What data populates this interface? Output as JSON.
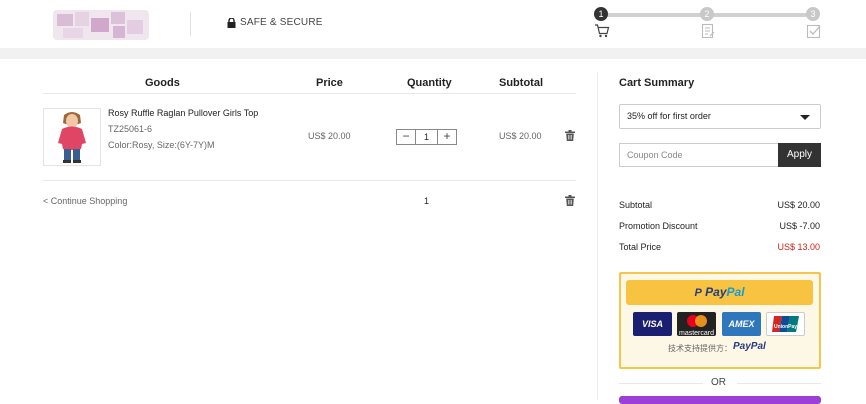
{
  "header": {
    "secure_label": "SAFE & SECURE",
    "steps": [
      "1",
      "2",
      "3"
    ]
  },
  "cart": {
    "columns": [
      "Goods",
      "Price",
      "Quantity",
      "Subtotal"
    ],
    "items": [
      {
        "name": "Rosy Ruffle Raglan Pullover Girls Top",
        "sku": "TZ25061-6",
        "options": "Color:Rosy, Size:(6Y-7Y)M",
        "price": "US$ 20.00",
        "quantity": "1",
        "subtotal": "US$ 20.00"
      }
    ],
    "continue_label": "< Continue Shopping",
    "total_quantity": "1"
  },
  "summary": {
    "title": "Cart Summary",
    "promo_selected": "35% off for first order",
    "coupon_placeholder": "Coupon Code",
    "apply_label": "Apply",
    "rows": [
      {
        "label": "Subtotal",
        "value": "US$  20.00"
      },
      {
        "label": "Promotion Discount",
        "value": "US$  -7.00"
      },
      {
        "label": "Total Price",
        "value": "US$  13.00"
      }
    ],
    "paypal": {
      "button_p1": "Pay",
      "button_p2": "Pal",
      "cards": [
        "VISA",
        "mastercard",
        "AMEX",
        "UnionPay"
      ],
      "provided_by": "技术支持提供方：",
      "provided_logo": "PayPal"
    },
    "or_label": "OR"
  },
  "colors": {
    "accent_red": "#d0201a",
    "paypal_yellow": "#f8c340",
    "dark": "#333333"
  }
}
